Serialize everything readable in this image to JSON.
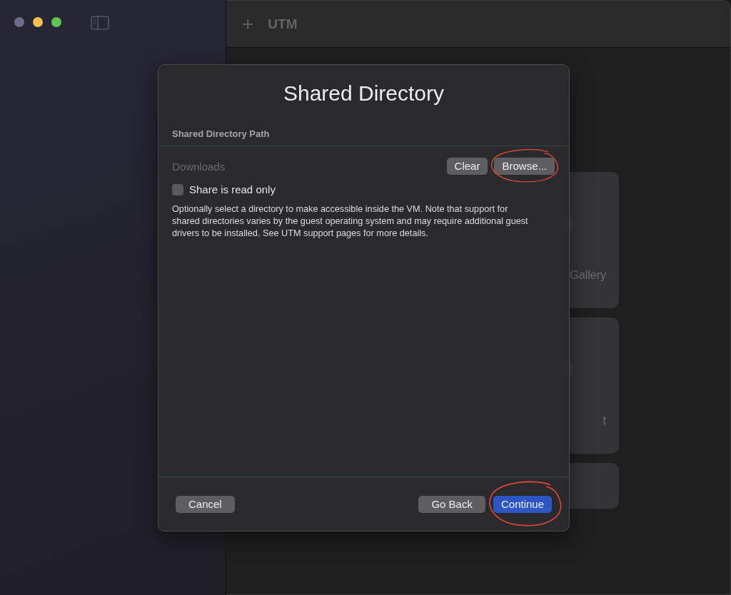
{
  "window": {
    "traffic_lights": [
      {
        "color": "#6e6a8a"
      },
      {
        "color": "#f6bf4f"
      },
      {
        "color": "#5ec552"
      }
    ]
  },
  "toolbar": {
    "add_button": "+",
    "title": "UTM"
  },
  "cards": [
    {
      "kind": "tall",
      "label": "Gallery"
    },
    {
      "kind": "tall",
      "label": "t"
    },
    {
      "kind": "short"
    }
  ],
  "dialog": {
    "title": "Shared Directory",
    "section": "Shared Directory Path",
    "path_field": {
      "placeholder": "Downloads"
    },
    "path_buttons": [
      {
        "label": "Clear",
        "highlighted": false
      },
      {
        "label": "Browse...",
        "highlighted": true
      }
    ],
    "read_only": {
      "label": "Share is read only",
      "checked": false
    },
    "description": "Optionally select a directory to make accessible inside the VM. Note that support for shared directories varies by the guest operating system and may require additional guest drivers to be installed. See UTM support pages for more details.",
    "footer_buttons": [
      {
        "label": "Cancel",
        "kind": "plain",
        "highlighted": false
      },
      {
        "label": "Go Back",
        "kind": "plain",
        "highlighted": false
      },
      {
        "label": "Continue",
        "kind": "primary",
        "highlighted": true
      }
    ]
  }
}
